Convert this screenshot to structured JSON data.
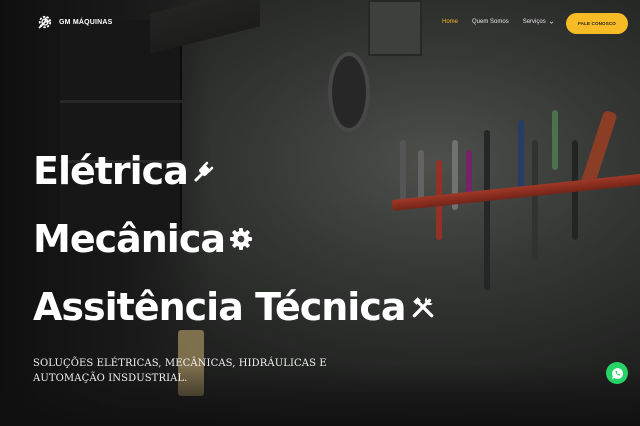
{
  "header": {
    "logo_text": "GM MÁQUINAS",
    "nav": [
      {
        "label": "Home",
        "active": true
      },
      {
        "label": "Quem Somos",
        "active": false
      },
      {
        "label": "Serviços",
        "active": false,
        "dropdown": true
      }
    ],
    "cta_label": "FALE CONOSCO"
  },
  "hero": {
    "line1": "Elétrica",
    "line1_icon": "plug-icon",
    "line2": "Mecânica",
    "line2_icon": "gear-icon",
    "line3": "Assitência Técnica",
    "line3_icon": "crossed-tools-icon",
    "subtitle": "SOLUÇÕES ELÉTRICAS, MECÂNICAS, HIDRÁULICAS E AUTOMAÇÃO INSDUSTRIAL."
  },
  "floating": {
    "whatsapp_icon": "whatsapp-icon"
  },
  "colors": {
    "accent": "#f7bc25",
    "nav_active": "#f4b82a",
    "whatsapp": "#25d366",
    "hero_text": "#ffffff"
  }
}
